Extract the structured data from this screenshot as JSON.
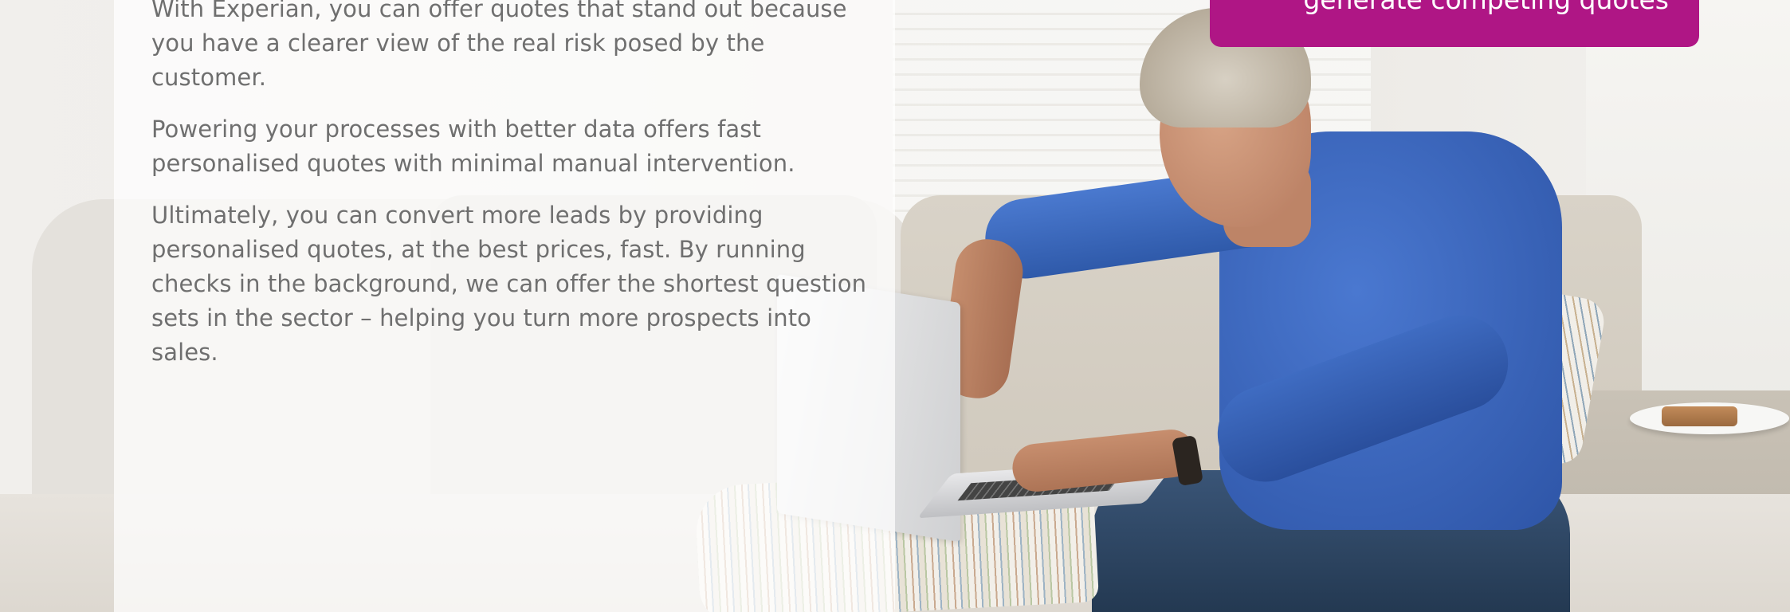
{
  "callout": {
    "text": "generate competing quotes",
    "color": "#af1685"
  },
  "body_copy": {
    "paragraphs": [
      "With Experian, you can offer quotes that stand out because you have a clearer view of the real risk posed by the customer.",
      "Powering your processes with better data offers fast personalised quotes with minimal manual intervention.",
      "Ultimately, you can convert more leads by providing personalised quotes, at the best prices, fast. By running checks in the background, we can offer the shortest question sets in the sector – helping you turn more prospects into sales."
    ],
    "text_color": "#6f6f6f"
  }
}
